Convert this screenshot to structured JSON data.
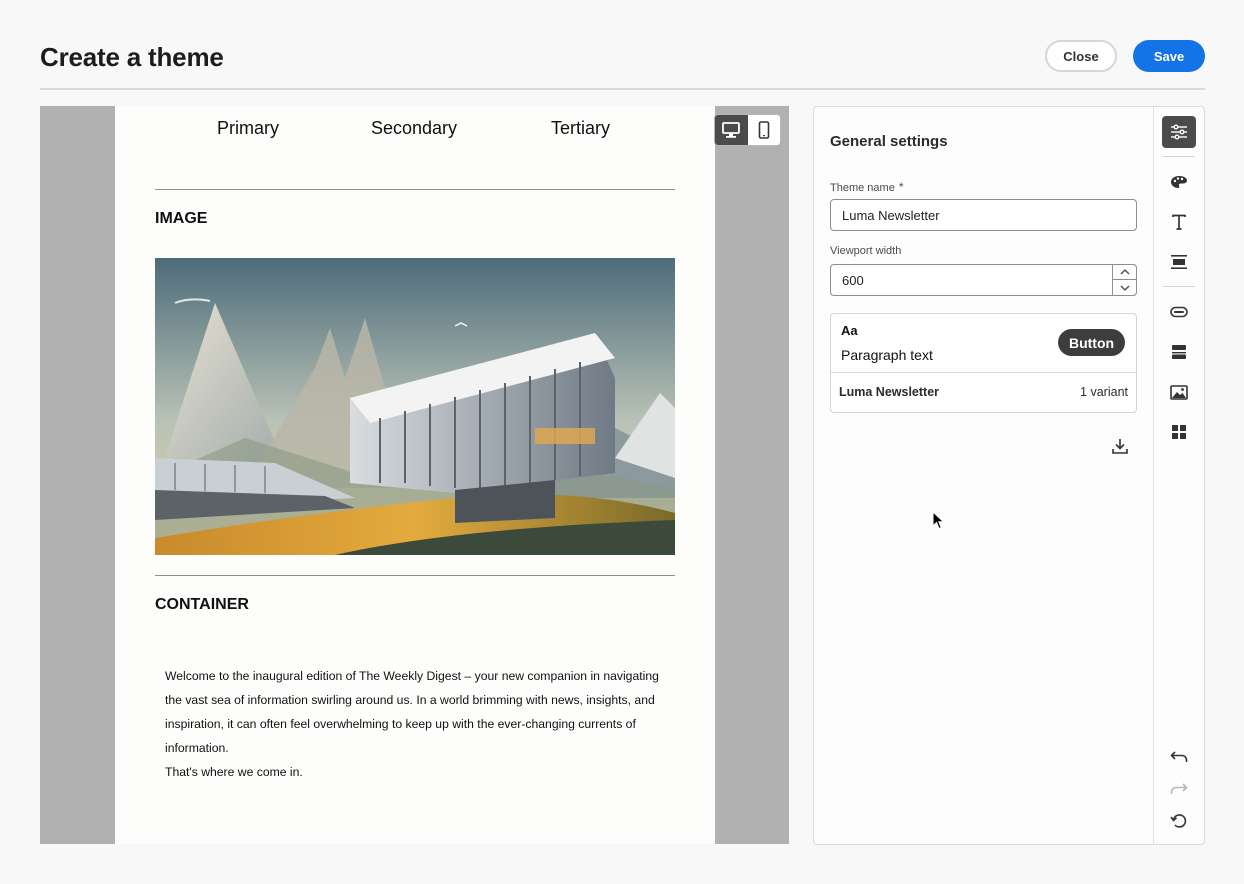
{
  "header": {
    "title": "Create a theme",
    "close_label": "Close",
    "save_label": "Save"
  },
  "email": {
    "nav": [
      "Primary",
      "Secondary",
      "Tertiary"
    ],
    "image_label": "IMAGE",
    "container_label": "CONTAINER",
    "paragraph_lines": [
      "Welcome to the inaugural edition of The Weekly Digest – your new companion in navigating",
      "the vast sea of information swirling around us. In a world brimming with news, insights, and",
      "inspiration, it can often feel overwhelming to keep up with the ever-changing currents of",
      "information.",
      "That's where we come in."
    ]
  },
  "device_toggle": {
    "selected": "desktop",
    "options": [
      "desktop-icon",
      "mobile-icon"
    ]
  },
  "settings": {
    "title": "General settings",
    "theme_name_label": "Theme name",
    "theme_name_required": "*",
    "theme_name_value": "Luma Newsletter",
    "viewport_label": "Viewport width",
    "viewport_value": "600",
    "preview": {
      "heading": "Aa",
      "paragraph": "Paragraph text",
      "button": "Button",
      "theme_name": "Luma Newsletter",
      "variants": "1 variant"
    }
  },
  "rail": {
    "top": [
      "general-settings-icon",
      "palette-icon",
      "text-icon",
      "divider-icon",
      "button-icon",
      "container-icon",
      "image-icon",
      "grid-icon"
    ],
    "bottom": [
      "undo-icon",
      "redo-icon",
      "reset-icon"
    ]
  },
  "colors": {
    "accent": "#1473e6",
    "canvas_bg": "#b1b1b1",
    "active_tool": "#4b4b4b"
  }
}
